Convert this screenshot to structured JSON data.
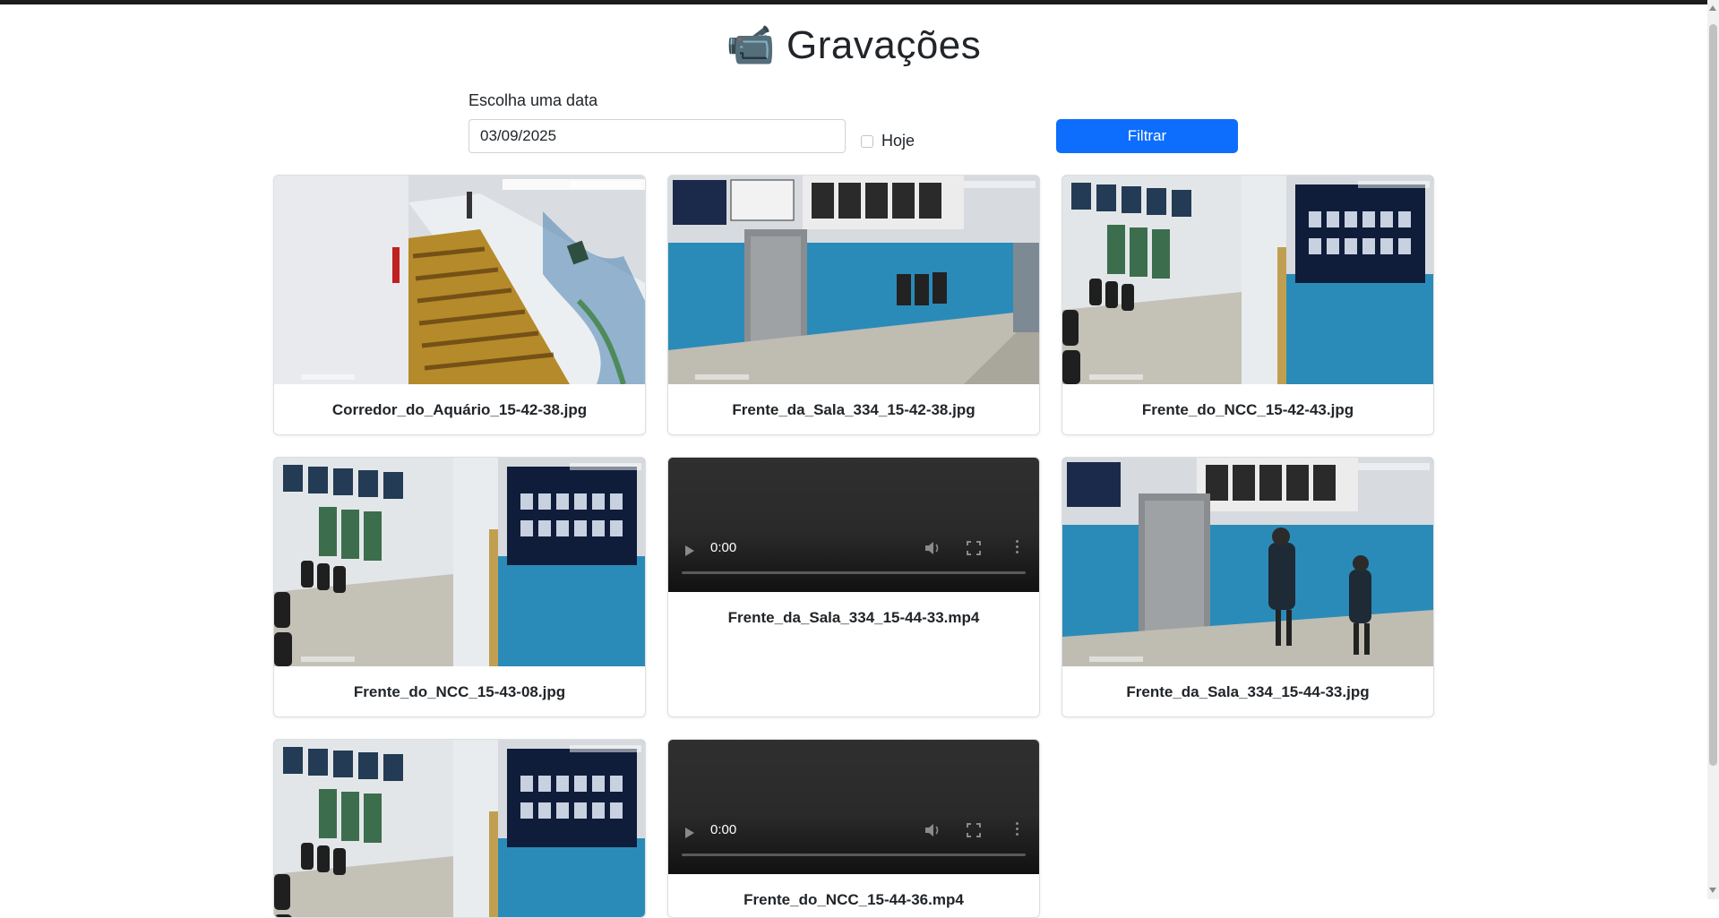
{
  "header": {
    "emoji": "📹",
    "title": "Gravações"
  },
  "filter": {
    "label": "Escolha uma data",
    "date_value": "03/09/2025",
    "today_label": "Hoje",
    "today_checked": false,
    "button_label": "Filtrar"
  },
  "recordings": [
    {
      "type": "image",
      "filename": "Corredor_do_Aquário_15-42-38.jpg",
      "scene": "corridor-checker-floor"
    },
    {
      "type": "image",
      "filename": "Frente_da_Sala_334_15-42-38.jpg",
      "scene": "blue-wall-door"
    },
    {
      "type": "image",
      "filename": "Frente_do_NCC_15-42-43.jpg",
      "scene": "blue-wall-boards"
    },
    {
      "type": "image",
      "filename": "Frente_do_NCC_15-43-08.jpg",
      "scene": "blue-wall-boards"
    },
    {
      "type": "video",
      "filename": "Frente_da_Sala_334_15-44-33.mp4",
      "time": "0:00"
    },
    {
      "type": "image",
      "filename": "Frente_da_Sala_334_15-44-33.jpg",
      "scene": "blue-wall-door"
    },
    {
      "type": "image",
      "filename": "",
      "scene": "blue-wall-boards"
    },
    {
      "type": "video",
      "filename": "Frente_do_NCC_15-44-36.mp4",
      "time": "0:00"
    }
  ],
  "colors": {
    "primary": "#0d6efd",
    "wall_blue": "#2b8bb8",
    "video_bg": "#2c2c2c"
  }
}
